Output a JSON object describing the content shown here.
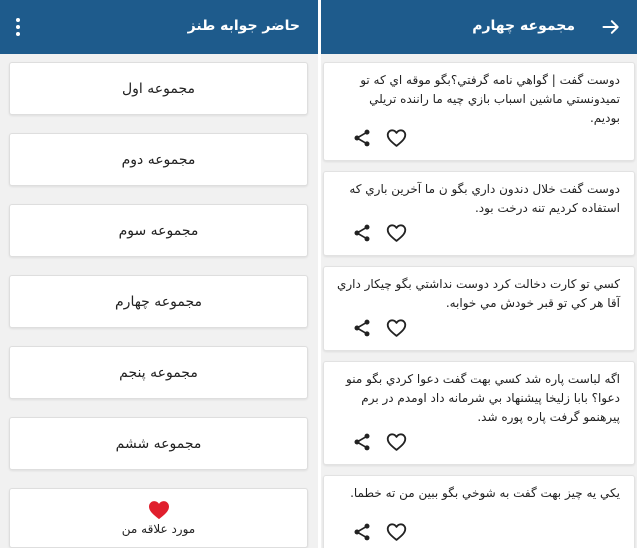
{
  "left_screen": {
    "title": "حاضر جوابه طنز",
    "menu_icon": "more-vert-icon",
    "collections": [
      {
        "label": "مجموعه اول"
      },
      {
        "label": "مجموعه دوم"
      },
      {
        "label": "مجموعه سوم"
      },
      {
        "label": "مجموعه چهارم"
      },
      {
        "label": "مجموعه پنجم"
      },
      {
        "label": "مجموعه ششم"
      }
    ],
    "favorites": {
      "label": "مورد علاقه من",
      "icon": "heart-icon",
      "icon_color": "#e01f2d"
    }
  },
  "right_screen": {
    "title": "مجموعه چهارم",
    "back_icon": "arrow-forward-icon",
    "jokes": [
      {
        "text": "دوست گفت | گواهي نامه گرفتي؟بگو موقه اي كه تو تميدونستي ماشين اسباب بازي چيه ما راننده تريلي بوديم."
      },
      {
        "text": "دوست گفت خلال دندون داري بگو ن ما آخرين باري كه استفاده كرديم تنه درخت بود."
      },
      {
        "text": "كسي تو كارت دخالت كرد دوست نداشتي بگو چيكار داري آقا هر كي تو قبر خودش مي خوابه."
      },
      {
        "text": "اگه لباست پاره شد كسي بهت گفت دعوا كردي بگو منو دعوا؟ بابا زليخا پيشنهاد بي شرمانه داد اومدم در برم پيرهنمو گرفت پاره پوره شد."
      },
      {
        "text": "يكي يه چيز بهت گفت به شوخي بگو ببين من ته خطما."
      }
    ]
  },
  "colors": {
    "app_bar": "#1e5b8c",
    "background": "#f1f1f1",
    "card": "#ffffff",
    "favorite_heart": "#e01f2d"
  }
}
